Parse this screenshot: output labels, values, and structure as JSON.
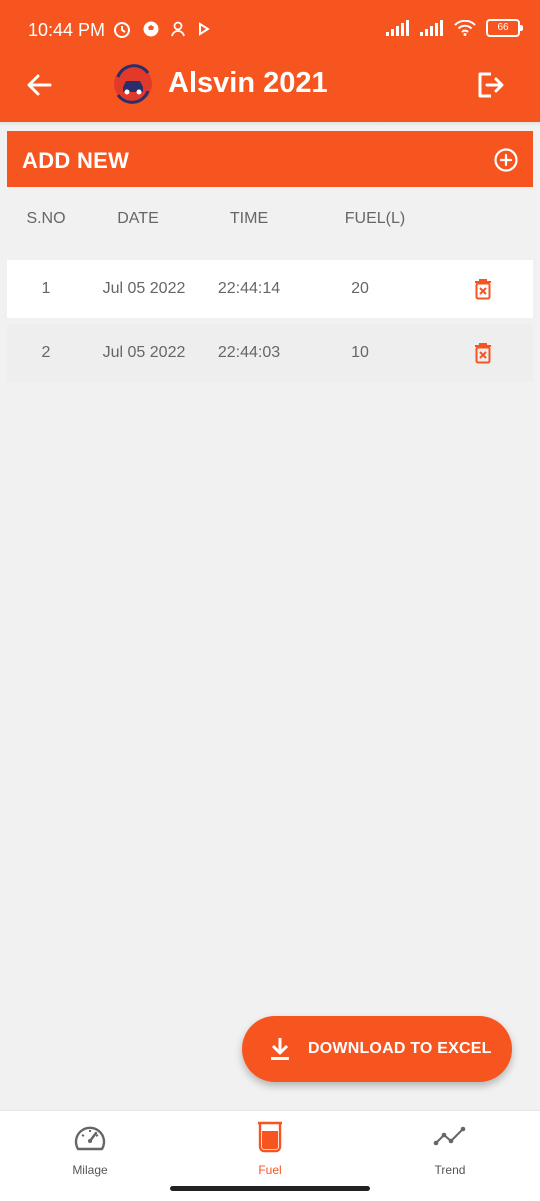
{
  "status_bar": {
    "time": "10:44 PM",
    "battery": "66",
    "left_icons": [
      "alarm-icon",
      "soccer-ball-icon",
      "person-icon",
      "play-icon"
    ],
    "right_icons": [
      "signal-icon",
      "signal-icon",
      "wifi-icon",
      "battery-icon"
    ]
  },
  "header": {
    "title": "Alsvin 2021",
    "back_icon": "arrow-left-icon",
    "exit_icon": "logout-icon",
    "logo_icon": "car-logo-icon"
  },
  "add_bar": {
    "label": "ADD NEW",
    "icon": "plus-circle-icon"
  },
  "table": {
    "headers": [
      "S.NO",
      "DATE",
      "TIME",
      "FUEL(L)"
    ],
    "rows": [
      {
        "sno": "1",
        "date": "Jul 05 2022",
        "time": "22:44:14",
        "fuel": "20"
      },
      {
        "sno": "2",
        "date": "Jul 05 2022",
        "time": "22:44:03",
        "fuel": "10"
      }
    ]
  },
  "fab": {
    "label": "DOWNLOAD TO EXCEL",
    "icon": "download-icon"
  },
  "bottom_nav": {
    "items": [
      {
        "label": "Milage",
        "icon": "speedometer-icon",
        "active": false
      },
      {
        "label": "Fuel",
        "icon": "fuel-beaker-icon",
        "active": true
      },
      {
        "label": "Trend",
        "icon": "trend-line-icon",
        "active": false
      }
    ]
  },
  "colors": {
    "primary": "#f6551f",
    "background": "#f1f1f1",
    "text_muted": "#666666"
  }
}
